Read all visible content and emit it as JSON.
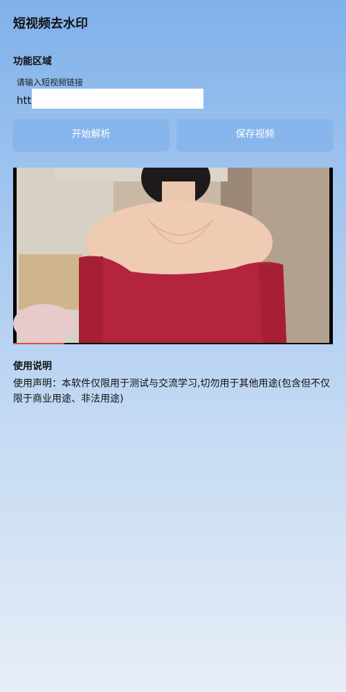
{
  "app": {
    "title": "短视频去水印"
  },
  "function_area": {
    "title": "功能区域",
    "input_label": "请输入短视频链接",
    "input_value": "htt"
  },
  "buttons": {
    "parse": "开始解析",
    "save": "保存视频"
  },
  "video": {
    "description": "woman-in-red-off-shoulder-top-video-preview",
    "progress": 0.16
  },
  "usage": {
    "title": "使用说明",
    "text": "使用声明：本软件仅限用于测试与交流学习,切勿用于其他用途(包含但不仅限于商业用途、非法用途)"
  },
  "colors": {
    "button": "#86b6ec",
    "progress": "#e04a4a",
    "accent": "#7fb1ea"
  }
}
